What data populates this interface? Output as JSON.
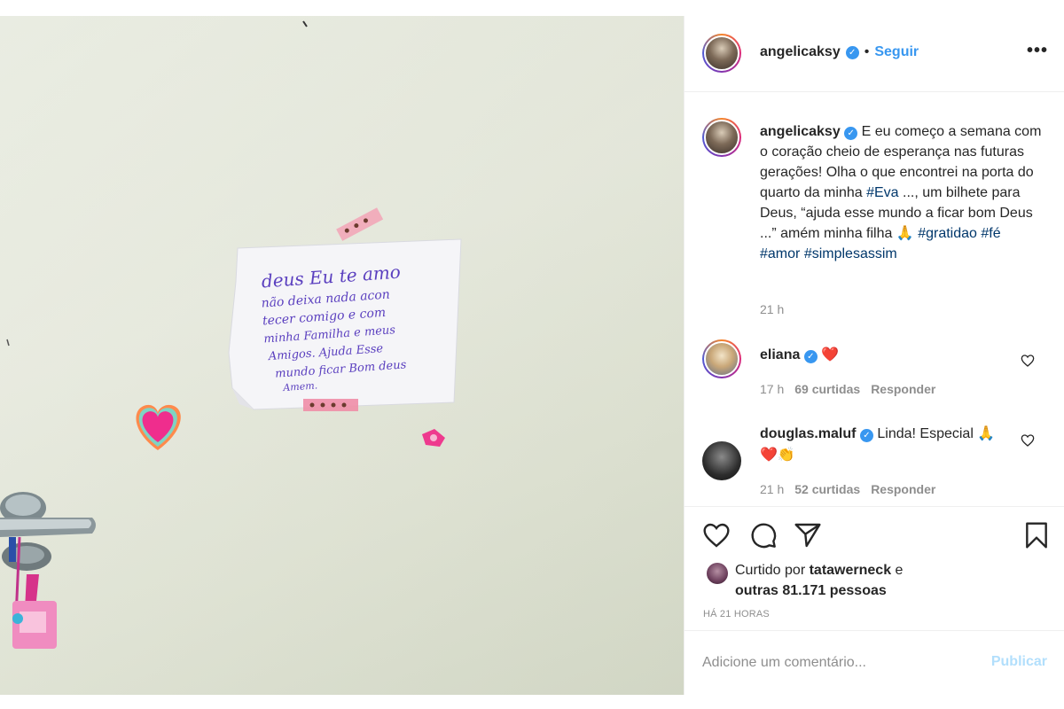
{
  "post": {
    "author": "angelicaksy",
    "follow_label": "Seguir",
    "separator": "•",
    "more_label": "•••"
  },
  "caption": {
    "user": "angelicaksy",
    "text_1": "E eu começo a semana com o coração cheio de esperança nas futuras gerações! Olha o que encontrei na porta do quarto da minha ",
    "tag_eva": "#Eva",
    "text_2": " ..., um bilhete para Deus, “ajuda esse mundo a ficar bom Deus ...” amém minha filha 🙏 ",
    "tag_gratidao": "#gratidao",
    "tag_fe": "#fé",
    "tag_amor": "#amor",
    "tag_simples": "#simplesassim",
    "time": "21 h"
  },
  "comments": [
    {
      "user": "eliana",
      "text": "❤️",
      "time": "17 h",
      "likes": "69 curtidas",
      "reply": "Responder"
    },
    {
      "user": "douglas.maluf",
      "text": "Linda! Especial 🙏❤️👏",
      "time": "21 h",
      "likes": "52 curtidas",
      "reply": "Responder"
    }
  ],
  "likes": {
    "prefix": "Curtido por ",
    "user": "tatawerneck",
    "suffix_1": " e",
    "suffix_2": "outras 81.171 pessoas"
  },
  "posted_ago": "HÁ 21 HORAS",
  "comment_box": {
    "placeholder": "Adicione um comentário...",
    "publish_label": "Publicar"
  },
  "note": {
    "line_1": "deus  Eu te amo",
    "line_2": "não deixa nada acon",
    "line_3": "tecer comigo e com",
    "line_4": "minha Familha e meus",
    "line_5": "Amigos. Ajuda Esse",
    "line_6": "mundo ficar Bom deus",
    "line_7": "Amem."
  },
  "colors": {
    "link": "#00376b",
    "follow": "#3897f0",
    "muted": "#8e8e8e",
    "heart": "#ed4956",
    "publish_disabled": "#b2dffc"
  }
}
